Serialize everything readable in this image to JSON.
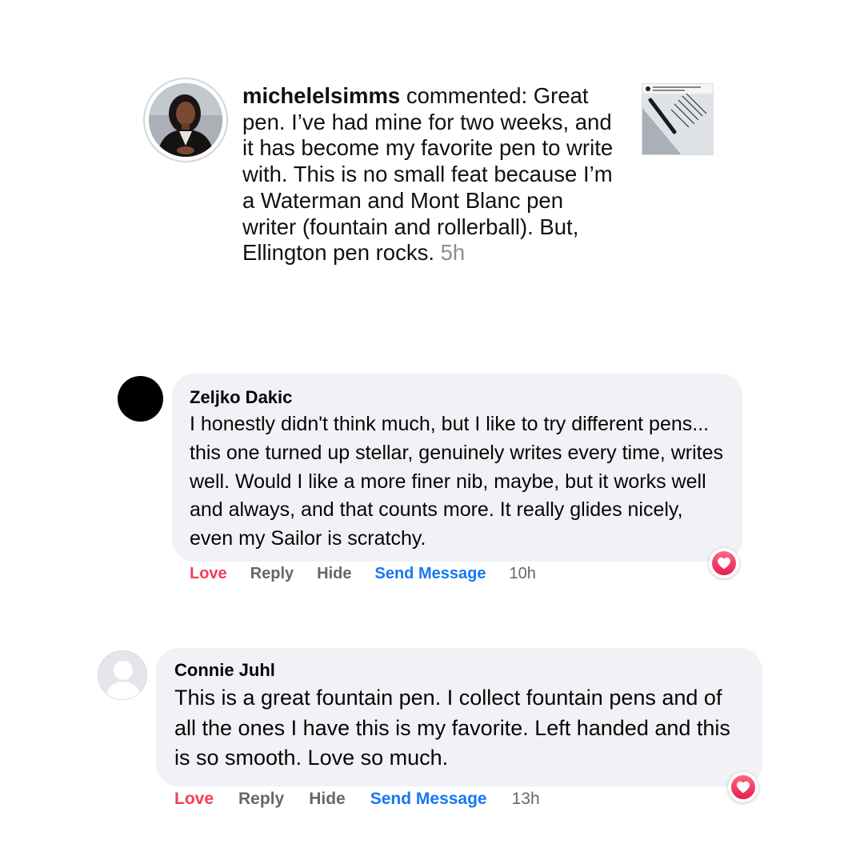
{
  "instagram_comment": {
    "username": "michelelsimms",
    "comment_text": " commented: Great pen. I’ve had mine for two weeks, and it has become my favorite pen to write with. This is no small feat because I’m a Waterman and Mont Blanc pen writer (fountain and rollerball). But, Ellington pen rocks.",
    "time": "5h",
    "avatar_icon": "profile-photo",
    "thumbnail_icon": "post-thumbnail"
  },
  "facebook_comments": [
    {
      "name": "Zeljko Dakic",
      "text": "I honestly didn't think much, but I like to try different pens... this one turned up stellar, genuinely writes every time, writes well. Would I like a more finer nib, maybe, but it works well and always, and that counts more. It really glides nicely, even my Sailor is scratchy.",
      "actions": {
        "love": "Love",
        "reply": "Reply",
        "hide": "Hide",
        "send_message": "Send Message"
      },
      "time": "10h",
      "reaction_icon": "heart-icon"
    },
    {
      "name": "Connie Juhl",
      "text": "This is a great fountain pen. I collect fountain pens and of all the ones I have this is my favorite. Left handed and this is so smooth. Love so much.",
      "actions": {
        "love": "Love",
        "reply": "Reply",
        "hide": "Hide",
        "send_message": "Send Message"
      },
      "time": "13h",
      "reaction_icon": "heart-icon"
    }
  ],
  "colors": {
    "love": "#f33e58",
    "send_message": "#1877f2",
    "action_gray": "#65676b",
    "bubble_bg": "#f0f2f5",
    "timestamp_gray": "#8e8e8e"
  }
}
